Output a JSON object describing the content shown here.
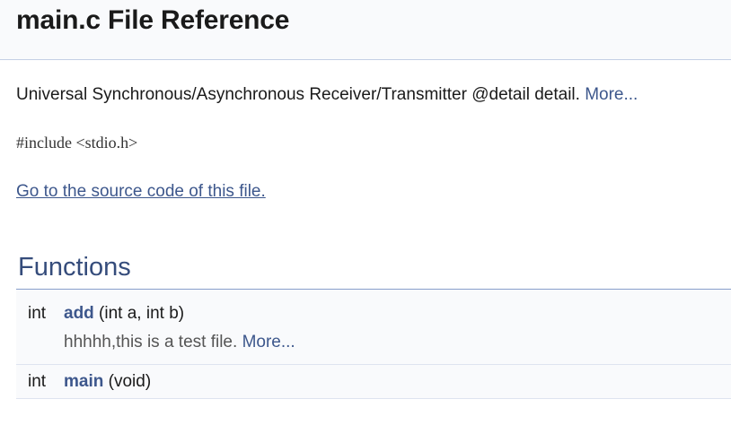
{
  "header": {
    "title": "main.c File Reference"
  },
  "brief": {
    "text": "Universal Synchronous/Asynchronous Receiver/Transmitter @detail detail. ",
    "more_label": "More..."
  },
  "include": {
    "text": "#include <stdio.h>"
  },
  "source_link": {
    "label": "Go to the source code of this file."
  },
  "functions": {
    "title": "Functions",
    "items": [
      {
        "type": "int",
        "name": "add",
        "params": " (int a, int b)",
        "description": "hhhhh,this is a test file. ",
        "more_label": "More..."
      },
      {
        "type": "int",
        "name": "main",
        "params": " (void)"
      }
    ]
  },
  "colors": {
    "link": "#3d578c",
    "section_title": "#354c7b",
    "header_bg": "#f9fafc"
  }
}
